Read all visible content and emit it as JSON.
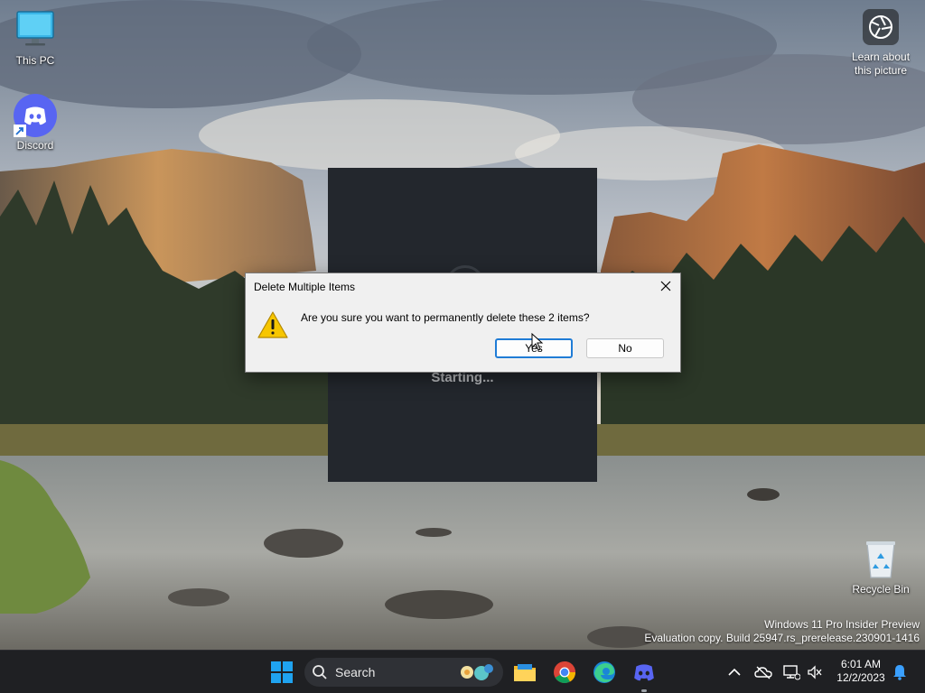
{
  "desktop": {
    "icons": [
      {
        "label": "This PC",
        "icon": "monitor-icon"
      },
      {
        "label": "Discord",
        "icon": "discord-icon"
      },
      {
        "label": "Recycle Bin",
        "icon": "recycle-bin-icon"
      }
    ],
    "learn_label_line1": "Learn about",
    "learn_label_line2": "this picture"
  },
  "splash": {
    "status": "Starting..."
  },
  "dialog": {
    "title": "Delete Multiple Items",
    "message": "Are you sure you want to permanently delete these 2 items?",
    "yes_label": "Yes",
    "no_label": "No",
    "icon": "warning-icon"
  },
  "watermark": {
    "line1": "Windows 11 Pro Insider Preview",
    "line2": "Evaluation copy. Build 25947.rs_prerelease.230901-1416"
  },
  "taskbar": {
    "search_placeholder": "Search",
    "pinned": [
      "start-button",
      "file-explorer-icon",
      "chrome-icon",
      "edge-icon",
      "discord-icon"
    ],
    "accent": "#0078d4"
  },
  "tray": {
    "time": "6:01 AM",
    "date": "12/2/2023"
  }
}
